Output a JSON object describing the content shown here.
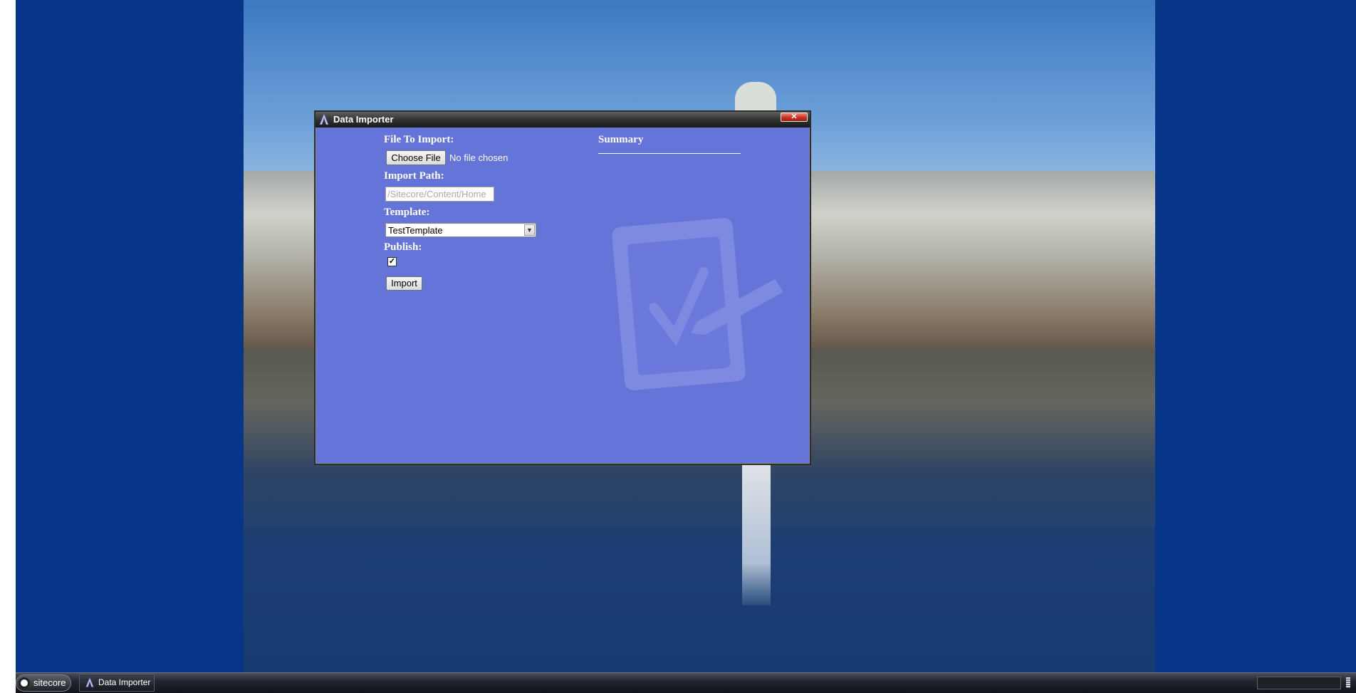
{
  "window": {
    "title": "Data Importer",
    "close_label": "✕"
  },
  "form": {
    "file_label": "File To Import:",
    "choose_file_label": "Choose File",
    "file_status": "No file chosen",
    "path_label": "Import Path:",
    "path_value": "",
    "path_placeholder": "/Sitecore/Content/Home",
    "template_label": "Template:",
    "template_selected": "TestTemplate",
    "publish_label": "Publish:",
    "publish_checked": true,
    "import_button_label": "Import"
  },
  "summary": {
    "title": "Summary"
  },
  "taskbar": {
    "start_label": "sitecore",
    "tasks": [
      {
        "label": "Data Importer",
        "icon": "sitecore-app-icon"
      }
    ]
  },
  "colors": {
    "desktop": "#073587",
    "dialog_bg": "#6474d9",
    "titlebar": "#2f2f2f",
    "close_button": "#c8321e"
  }
}
